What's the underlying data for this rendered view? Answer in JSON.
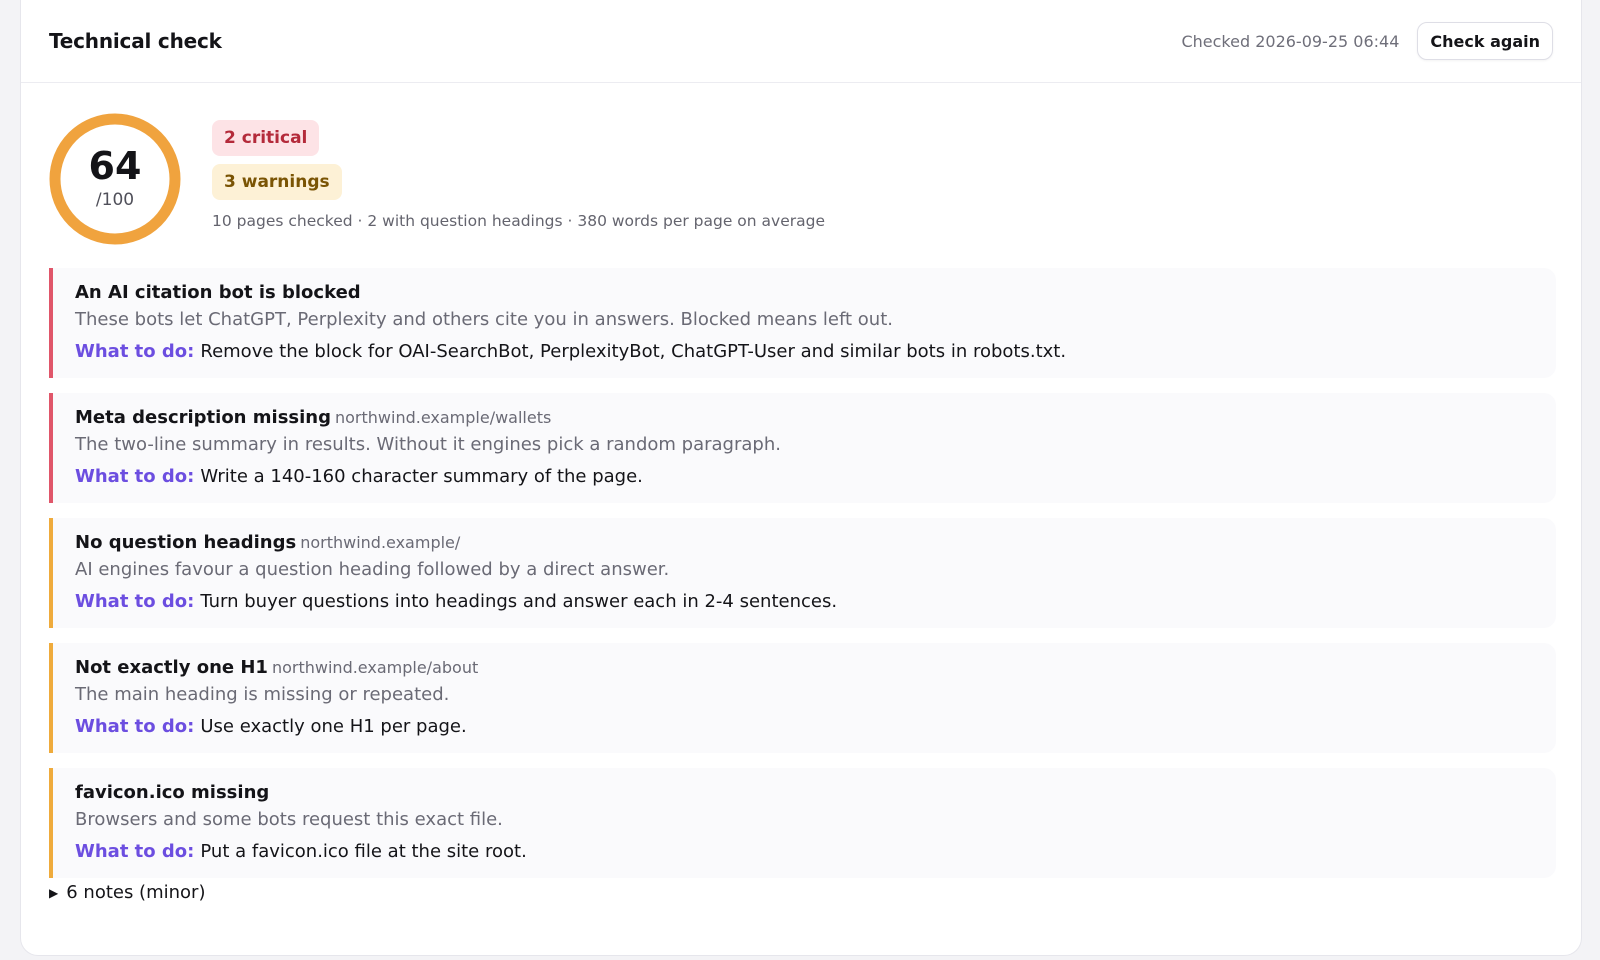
{
  "header": {
    "title": "Technical check",
    "checked": "Checked 2026-09-25 06:44",
    "check_again": "Check again"
  },
  "score": {
    "value": "64",
    "out_of": "/100",
    "fraction": 0.64,
    "ring_color": "#f0a33e"
  },
  "badges": {
    "critical": "2 critical",
    "warnings": "3 warnings"
  },
  "stats": "10 pages checked · 2 with question headings · 380 words per page on average",
  "todo_label": "What to do:",
  "issues": [
    {
      "severity": "critical",
      "title": "An AI citation bot is blocked",
      "url": "",
      "description": "These bots let ChatGPT, Perplexity and others cite you in answers. Blocked means left out.",
      "action": "Remove the block for OAI-SearchBot, PerplexityBot, ChatGPT-User and similar bots in robots.txt."
    },
    {
      "severity": "critical",
      "title": "Meta description missing",
      "url": "northwind.example/wallets",
      "description": "The two-line summary in results. Without it engines pick a random paragraph.",
      "action": "Write a 140-160 character summary of the page."
    },
    {
      "severity": "warning",
      "title": "No question headings",
      "url": "northwind.example/",
      "description": "AI engines favour a question heading followed by a direct answer.",
      "action": "Turn buyer questions into headings and answer each in 2-4 sentences."
    },
    {
      "severity": "warning",
      "title": "Not exactly one H1",
      "url": "northwind.example/about",
      "description": "The main heading is missing or repeated.",
      "action": "Use exactly one H1 per page."
    },
    {
      "severity": "warning",
      "title": "favicon.ico missing",
      "url": "",
      "description": "Browsers and some bots request this exact file.",
      "action": "Put a favicon.ico file at the site root."
    }
  ],
  "notes": "6 notes (minor)",
  "colors": {
    "critical": "#e0566a",
    "warning": "#efab3c",
    "accent": "#6c4ee0"
  }
}
